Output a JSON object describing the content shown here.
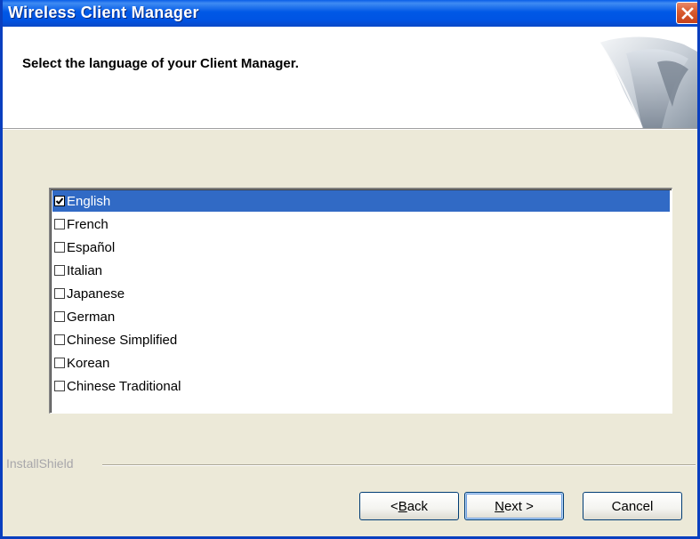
{
  "window": {
    "title": "Wireless  Client Manager"
  },
  "header": {
    "heading": "Select the language of your Client Manager."
  },
  "languages": [
    {
      "label": "English",
      "checked": true,
      "selected": true
    },
    {
      "label": "French",
      "checked": false,
      "selected": false
    },
    {
      "label": "Español",
      "checked": false,
      "selected": false
    },
    {
      "label": "Italian",
      "checked": false,
      "selected": false
    },
    {
      "label": "Japanese",
      "checked": false,
      "selected": false
    },
    {
      "label": "German",
      "checked": false,
      "selected": false
    },
    {
      "label": "Chinese Simplified",
      "checked": false,
      "selected": false
    },
    {
      "label": "Korean",
      "checked": false,
      "selected": false
    },
    {
      "label": "Chinese Traditional",
      "checked": false,
      "selected": false
    }
  ],
  "footer": {
    "brand": "InstallShield",
    "back_prefix": "< ",
    "back_mnemonic": "B",
    "back_rest": "ack",
    "next_mnemonic": "N",
    "next_rest": "ext >",
    "cancel_label": "Cancel"
  },
  "colors": {
    "titlebar": "#0054e3",
    "selection": "#316ac5",
    "close": "#d85a2e",
    "dialog_bg": "#ece9d8"
  },
  "icons": {
    "close": "close-icon",
    "check": "checkmark-icon"
  }
}
